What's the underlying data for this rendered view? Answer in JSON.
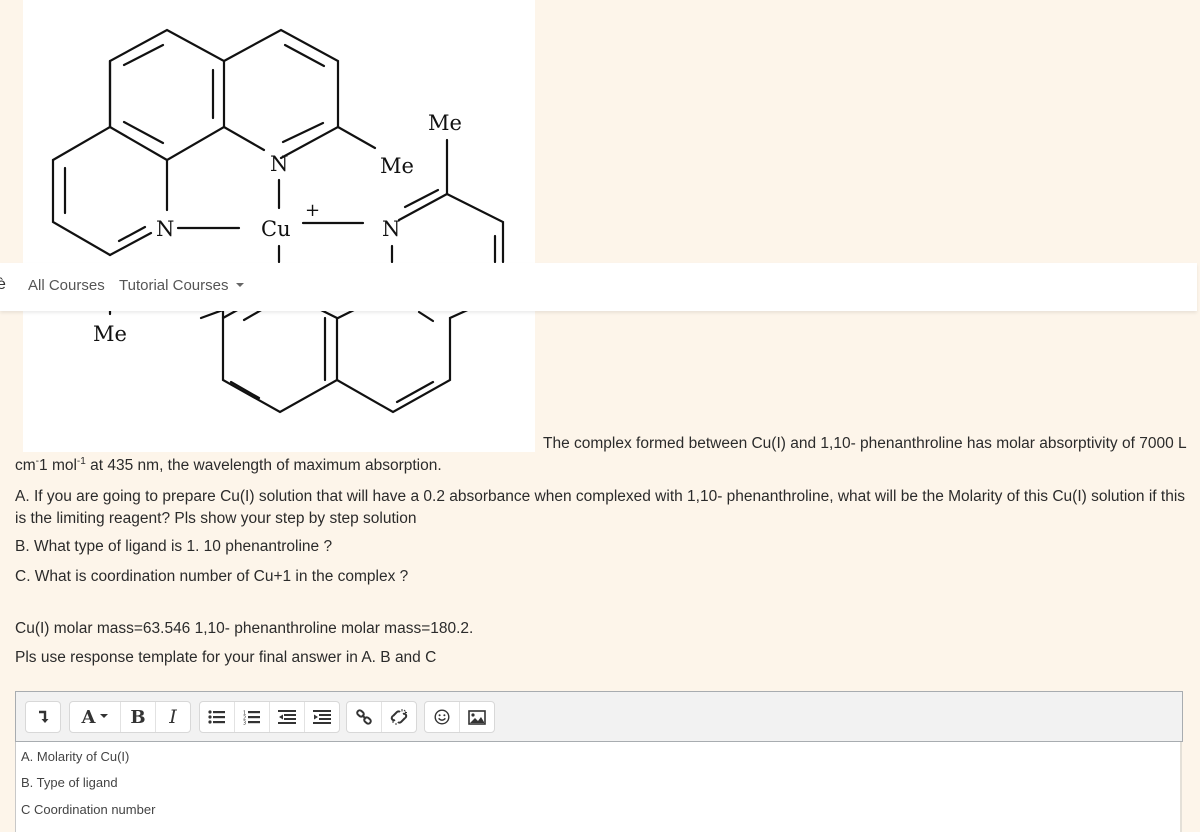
{
  "molecule_image": {
    "description": "Cu(I) bis(2,9-dimethyl-1,10-phenanthroline) complex structure",
    "labels": {
      "n_top": "N",
      "n_left": "N",
      "n_right": "N",
      "cu": "Cu",
      "charge": "+",
      "me_top_right": "Me",
      "me_mid": "Me",
      "me_bottom_left": "Me"
    }
  },
  "navbar": {
    "cut_item": "è",
    "items": [
      {
        "label": "All Courses"
      },
      {
        "label": "Tutorial Courses",
        "has_dropdown": true
      }
    ]
  },
  "question": {
    "intro": "The complex formed between Cu(I) and 1,10- phenanthroline has molar absorptivity of 7000 L",
    "units_prefix": "cm",
    "units_sup1": "-",
    "units_mid": "1 mol",
    "units_sup2": "-1",
    "units_suffix": " at 435 nm, the wavelength of  maximum absorption.",
    "part_a": "A.  If you are going to prepare   Cu(I) solution that will have a 0.2 absorbance when complexed with 1,10- phenanthroline, what will be the Molarity of this Cu(I) solution if this is the limiting reagent?  Pls show your step by step solution",
    "part_b": "B. What type of ligand is 1. 10 phenantroline ?",
    "part_c": "C. What is coordination number of Cu+1 in the complex ?",
    "masses": "Cu(I) molar mass=63.546  1,10- phenanthroline molar mass=180.2.",
    "template_note": "Pls use response template for your final answer in A. B and C"
  },
  "editor": {
    "toolbar": {
      "groups": [
        [
          {
            "name": "show-more-buttons",
            "icon": "collapse-arrow-icon"
          }
        ],
        [
          {
            "name": "font-style",
            "icon": "font-style-icon",
            "label": "A"
          },
          {
            "name": "bold",
            "icon": "bold-icon",
            "label": "B"
          },
          {
            "name": "italic",
            "icon": "italic-icon",
            "label": "I"
          }
        ],
        [
          {
            "name": "unordered-list",
            "icon": "bullet-list-icon"
          },
          {
            "name": "ordered-list",
            "icon": "numbered-list-icon"
          },
          {
            "name": "outdent",
            "icon": "outdent-icon"
          },
          {
            "name": "indent",
            "icon": "indent-icon"
          }
        ],
        [
          {
            "name": "link",
            "icon": "link-icon"
          },
          {
            "name": "unlink",
            "icon": "unlink-icon"
          }
        ],
        [
          {
            "name": "emoji",
            "icon": "emoji-icon"
          },
          {
            "name": "image",
            "icon": "image-icon"
          }
        ]
      ]
    },
    "content_lines": [
      "A. Molarity of Cu(I)",
      "B. Type of ligand",
      "C Coordination number"
    ]
  }
}
